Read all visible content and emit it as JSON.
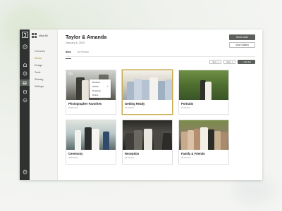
{
  "sidebar": {
    "view_all": "View All",
    "items": [
      {
        "label": "Overview"
      },
      {
        "label": "Media"
      },
      {
        "label": "Design"
      },
      {
        "label": "Tools"
      },
      {
        "label": "Sharing"
      },
      {
        "label": "Settings"
      }
    ]
  },
  "header": {
    "title": "Taylor & Amanda",
    "date": "January 6, 2020",
    "send_invite": "Send Invite",
    "view_gallery": "View Gallery"
  },
  "tabs": [
    {
      "label": "Sets"
    },
    {
      "label": "All Photos"
    }
  ],
  "toolbar": {
    "sort": "Sort",
    "view": "View",
    "add_set": "+ Add Set"
  },
  "cards": [
    {
      "title": "Photographer Favorites",
      "count": "58 Photos"
    },
    {
      "title": "Getting Ready",
      "count": "24 Photos"
    },
    {
      "title": "Portraits",
      "count": "79 Photos"
    },
    {
      "title": "Ceremony",
      "count": "48 Photos"
    },
    {
      "title": "Reception",
      "count": "42 Photos"
    },
    {
      "title": "Family & Friends",
      "count": "55 Photos"
    }
  ],
  "context_menu": {
    "items": [
      {
        "label": "Rename"
      },
      {
        "label": "Hidden"
      },
      {
        "label": "Duplicate"
      },
      {
        "label": "Delete"
      }
    ],
    "checked_index": 1
  },
  "colors": {
    "accent": "#a08a2c",
    "rail": "#2f3230",
    "primary_button": "#5c5f5c"
  }
}
